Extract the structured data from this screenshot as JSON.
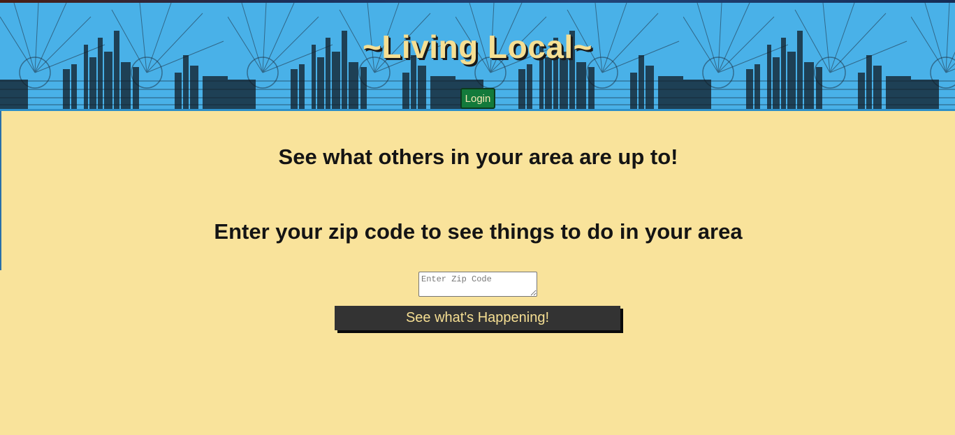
{
  "header": {
    "title": "~Living Local~",
    "login_label": "Login"
  },
  "main": {
    "heading_primary": "See what others in your area are up to!",
    "heading_secondary": "Enter your zip code to see things to do in your area",
    "zip_input": {
      "placeholder": "Enter Zip Code",
      "value": ""
    },
    "submit_label": "See what's Happening!"
  },
  "colors": {
    "header_blue": "#49b1e8",
    "title_gold": "#f6df93",
    "content_background": "#f9e39b",
    "login_green": "#137a3b",
    "submit_dark": "#333333"
  },
  "icons": {
    "header_background": "sunburst-skyline-pattern"
  }
}
